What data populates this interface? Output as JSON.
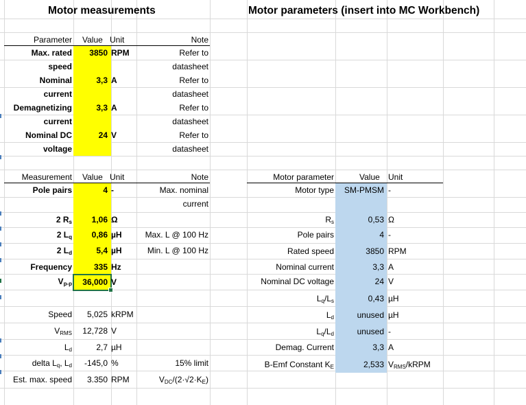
{
  "headers": {
    "left_title": "Motor measurements",
    "right_title": "Motor parameters (insert into MC Workbench)"
  },
  "table1": {
    "col_headers": [
      "Parameter",
      "Value",
      "Unit",
      "Note"
    ],
    "rows": [
      {
        "param_l1": "Max. rated",
        "param_l2": "speed",
        "value": "3850",
        "unit": "RPM",
        "note_l1": "Refer to",
        "note_l2": "datasheet"
      },
      {
        "param_l1": "Nominal",
        "param_l2": "current",
        "value": "3,3",
        "unit": "A",
        "note_l1": "Refer to",
        "note_l2": "datasheet"
      },
      {
        "param_l1": "Demagnetizing",
        "param_l2": "current",
        "value": "3,3",
        "unit": "A",
        "note_l1": "Refer to",
        "note_l2": "datasheet"
      },
      {
        "param_l1": "Nominal DC",
        "param_l2": "voltage",
        "value": "24",
        "unit": "V",
        "note_l1": "Refer to",
        "note_l2": "datasheet"
      }
    ]
  },
  "table2": {
    "col_headers": [
      "Measurement",
      "Value",
      "Unit",
      "Note"
    ],
    "pole_pairs": {
      "label": "Pole pairs",
      "value": "4",
      "unit": "-",
      "note_l1": "Max. nominal",
      "note_l2": "current"
    },
    "rs": {
      "prefix": "2 R",
      "sub": "s",
      "value": "1,06",
      "unit": "Ω"
    },
    "lq": {
      "prefix": "2 L",
      "sub": "q",
      "value": "0,86",
      "unit": "µH",
      "note": "Max. L @ 100 Hz"
    },
    "ld": {
      "prefix": "2 L",
      "sub": "d",
      "value": "5,4",
      "unit": "µH",
      "note": "Min. L @ 100 Hz"
    },
    "freq": {
      "label": "Frequency",
      "value": "335",
      "unit": "Hz"
    },
    "vpp": {
      "prefix": "V",
      "sub": "p-p",
      "value": "36,000",
      "unit": "V"
    }
  },
  "derived": {
    "speed": {
      "label": "Speed",
      "value": "5,025",
      "unit": "kRPM"
    },
    "vrms": {
      "prefix": "V",
      "sub": "RMS",
      "value": "12,728",
      "unit": "V"
    },
    "ld": {
      "prefix": "L",
      "sub": "d",
      "value": "2,7",
      "unit": "µH"
    },
    "delta": {
      "label": "delta L",
      "sub1": "q",
      "mid": ", L",
      "sub2": "d",
      "value": "-145,0",
      "unit": "%",
      "note": "15% limit"
    },
    "maxspeed": {
      "label": "Est. max. speed",
      "value": "3.350",
      "unit": "RPM",
      "note_pre": "V",
      "note_sub1": "DC",
      "note_mid": "/(2·√2·K",
      "note_sub2": "E",
      "note_post": ")"
    }
  },
  "params": {
    "col_headers": [
      "Motor parameter",
      "Value",
      "Unit"
    ],
    "motor_type": {
      "label": "Motor type",
      "value": "SM-PMSM",
      "unit": "-"
    },
    "rs": {
      "prefix": "R",
      "sub": "s",
      "value": "0,53",
      "unit": "Ω"
    },
    "pole_pairs": {
      "label": "Pole pairs",
      "value": "4",
      "unit": "-"
    },
    "rated_speed": {
      "label": "Rated speed",
      "value": "3850",
      "unit": "RPM"
    },
    "nominal_current": {
      "label": "Nominal current",
      "value": "3,3",
      "unit": "A"
    },
    "nominal_dc_voltage": {
      "label": "Nominal DC voltage",
      "value": "24",
      "unit": "V"
    },
    "lq_ls": {
      "p1": "L",
      "s1": "q",
      "p2": "/L",
      "s2": "s",
      "value": "0,43",
      "unit": "µH"
    },
    "ld": {
      "prefix": "L",
      "sub": "d",
      "value": "unused",
      "unit": "µH"
    },
    "lq_ld": {
      "p1": "L",
      "s1": "q",
      "p2": "/L",
      "s2": "d",
      "value": "unused",
      "unit": "-"
    },
    "demag": {
      "label": "Demag. Current",
      "value": "3,3",
      "unit": "A"
    },
    "bemf": {
      "label": "B-Emf Constant K",
      "sub": "E",
      "value": "2,533",
      "unit_pre": "V",
      "unit_sub": "RMS",
      "unit_post": "/kRPM"
    }
  }
}
